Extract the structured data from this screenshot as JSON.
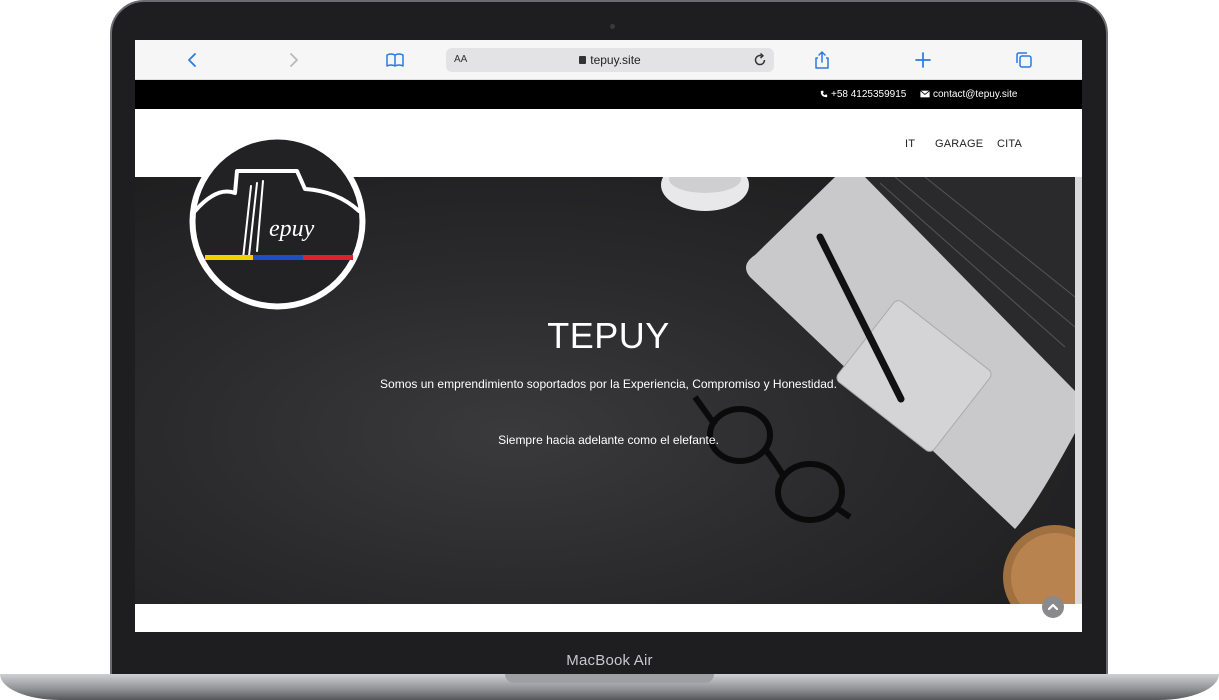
{
  "device": {
    "label": "MacBook Air"
  },
  "browser": {
    "text_size_label": "AA",
    "url_host": "tepuy.site",
    "icons": [
      "back-icon",
      "forward-icon",
      "bookmarks-icon",
      "lock-icon",
      "reload-icon",
      "share-icon",
      "new-tab-icon",
      "tabs-icon"
    ]
  },
  "topbar": {
    "phone": "+58 4125359915",
    "email": "contact@tepuy.site"
  },
  "nav": {
    "items": [
      "IT",
      "GARAGE",
      "CITA"
    ]
  },
  "hero": {
    "title": "TEPUY",
    "line1": "Somos un emprendimiento soportados por la Experiencia, Compromiso y Honestidad.",
    "line2": "Siempre hacia adelante como el elefante."
  },
  "logo": {
    "wordmark": "Tepuy"
  },
  "colors": {
    "accent": "#2a7ae2",
    "topbar": "#000000",
    "flag_yellow": "#f5d000",
    "flag_blue": "#1d4fc2",
    "flag_red": "#e0202a"
  }
}
